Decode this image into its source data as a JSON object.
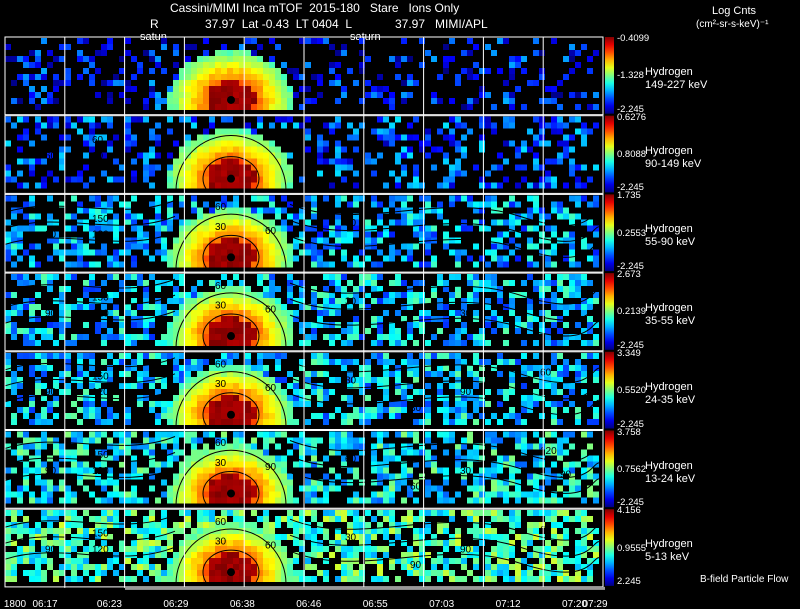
{
  "header": {
    "title": "Cassini/MIMI Inca mTOF  2015-180   Stare   Ions Only",
    "info_r": "R",
    "info_mid": "37.97  Lat -0.43  LT 0404  L",
    "info_right": "37.97   MIMI/APL",
    "saturn_1": "satun",
    "saturn_2": "saturn",
    "units_title": "Log Cnts",
    "units_sub": "(cm²-sr-s-keV)⁻¹"
  },
  "footer": {
    "legend_note": "B-field Particle Flow"
  },
  "chart_data": {
    "type": "heatmap",
    "time_labels": [
      "1800",
      "06:17",
      "06:23",
      "06:29",
      "06:38",
      "06:46",
      "06:55",
      "07:03",
      "07:12",
      "07:20",
      "07:29"
    ],
    "panels": [
      {
        "species": "Hydrogen",
        "energy": "149-227 keV",
        "cb_max": "-0.4099",
        "cb_mid": "-1.328",
        "cb_min": "-2.245",
        "level": 0.05,
        "contours": []
      },
      {
        "species": "Hydrogen",
        "energy": "90-149 keV",
        "cb_max": "0.6276",
        "cb_mid": "0.8088",
        "cb_min": "-2.245",
        "level": 0.15,
        "contours": [
          "60",
          "30",
          "60"
        ]
      },
      {
        "species": "Hydrogen",
        "energy": "55-90 keV",
        "cb_max": "1.735",
        "cb_mid": "0.2553",
        "cb_min": "-2.245",
        "level": 0.32,
        "contours": [
          "150",
          "120",
          "90",
          "60",
          "30",
          "60",
          "30"
        ]
      },
      {
        "species": "Hydrogen",
        "energy": "35-55 keV",
        "cb_max": "2.673",
        "cb_mid": "0.2139",
        "cb_min": "-2.245",
        "level": 0.36,
        "contours": [
          "150",
          "120",
          "90",
          "60",
          "30",
          "60",
          "30",
          "30"
        ]
      },
      {
        "species": "Hydrogen",
        "energy": "24-35 keV",
        "cb_max": "3.349",
        "cb_mid": "0.5520",
        "cb_min": "-2.245",
        "level": 0.38,
        "contours": [
          "150",
          "120",
          "90",
          "60",
          "30",
          "60",
          "30",
          "90",
          "60",
          "30"
        ]
      },
      {
        "species": "Hydrogen",
        "energy": "13-24 keV",
        "cb_max": "3.758",
        "cb_mid": "0.7562",
        "cb_min": "-2.245",
        "level": 0.45,
        "contours": [
          "150",
          "120",
          "90",
          "60",
          "30",
          "90",
          "60",
          "30",
          "120",
          "60",
          "90"
        ]
      },
      {
        "species": "Hydrogen",
        "energy": "5-13 keV",
        "cb_max": "4.156",
        "cb_mid": "0.9555",
        "cb_min": "2.245",
        "level": 0.58,
        "contours": [
          "150",
          "120",
          "90",
          "60",
          "30",
          "60",
          "30",
          "90",
          "60",
          "90"
        ]
      }
    ]
  }
}
